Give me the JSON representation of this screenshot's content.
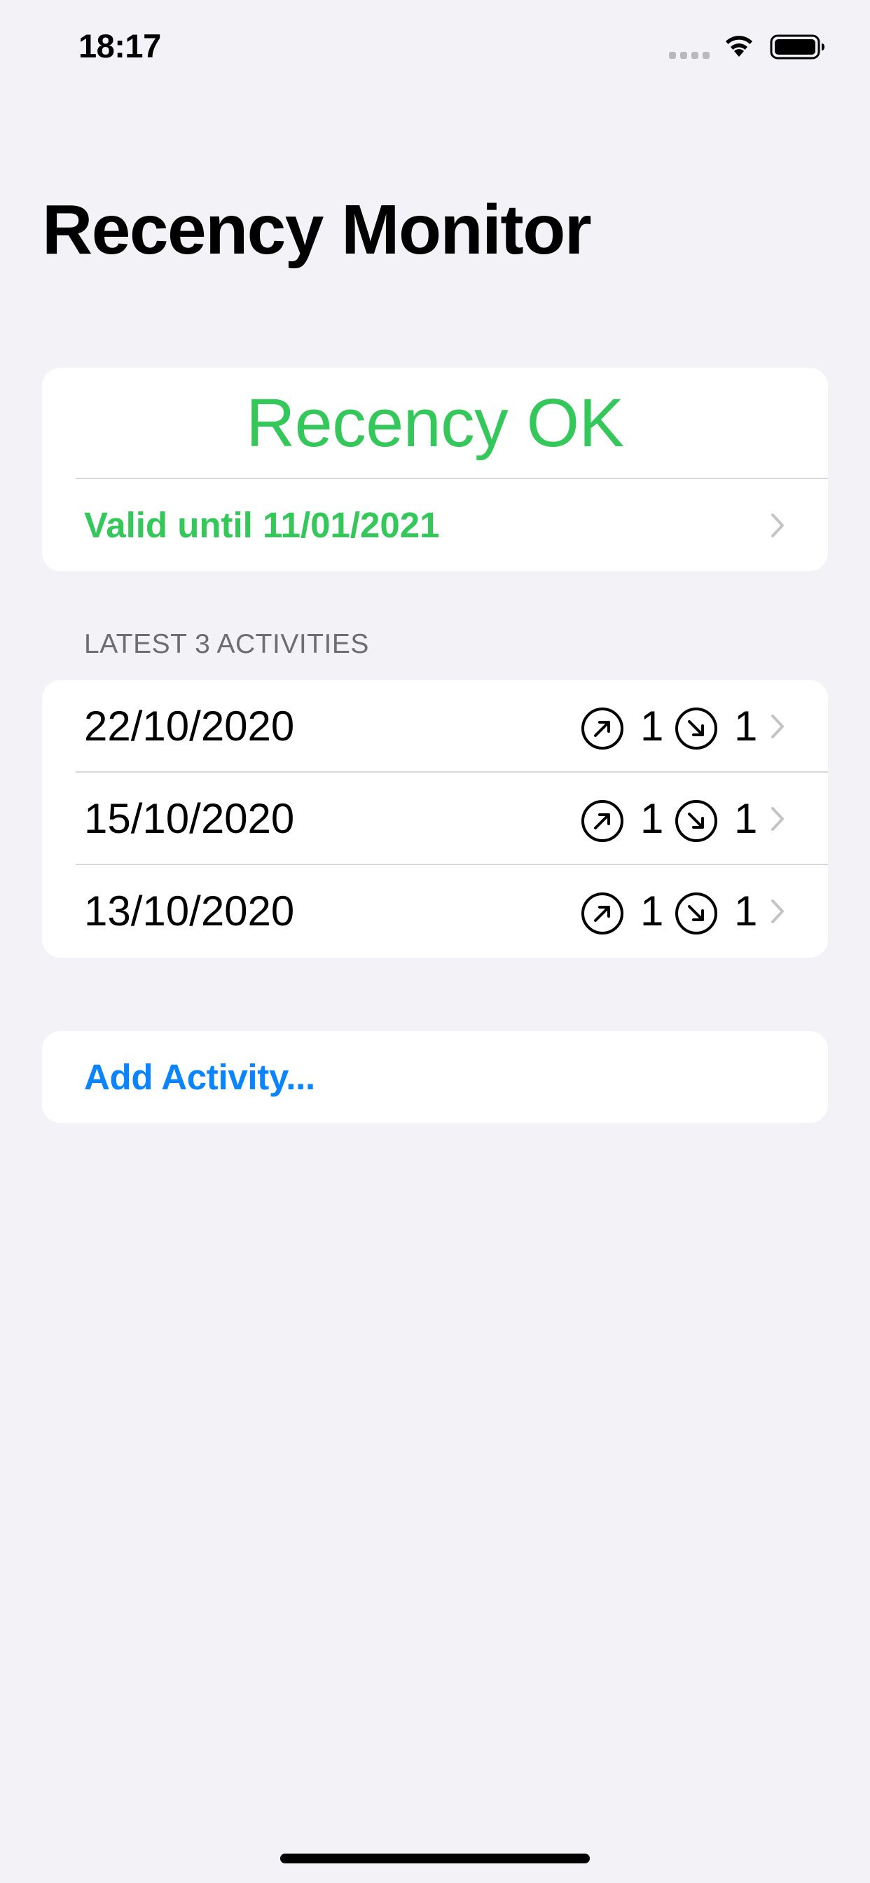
{
  "status_bar": {
    "time": "18:17",
    "icons": [
      "cellular-signal-icon",
      "wifi-icon",
      "battery-icon"
    ]
  },
  "title": "Recency Monitor",
  "recency": {
    "headline": "Recency OK",
    "valid_until": "Valid until 11/01/2021"
  },
  "activities": {
    "header": "LATEST 3 ACTIVITIES",
    "items": [
      {
        "date": "22/10/2020",
        "takeoffs": "1",
        "landings": "1"
      },
      {
        "date": "15/10/2020",
        "takeoffs": "1",
        "landings": "1"
      },
      {
        "date": "13/10/2020",
        "takeoffs": "1",
        "landings": "1"
      }
    ]
  },
  "add_activity": {
    "label": "Add Activity..."
  },
  "colors": {
    "ok_green": "#34c759",
    "link_blue": "#0a84ff",
    "background": "#f2f2f7",
    "secondary_text": "#6d6d72",
    "chevron": "#c4c4c7"
  }
}
